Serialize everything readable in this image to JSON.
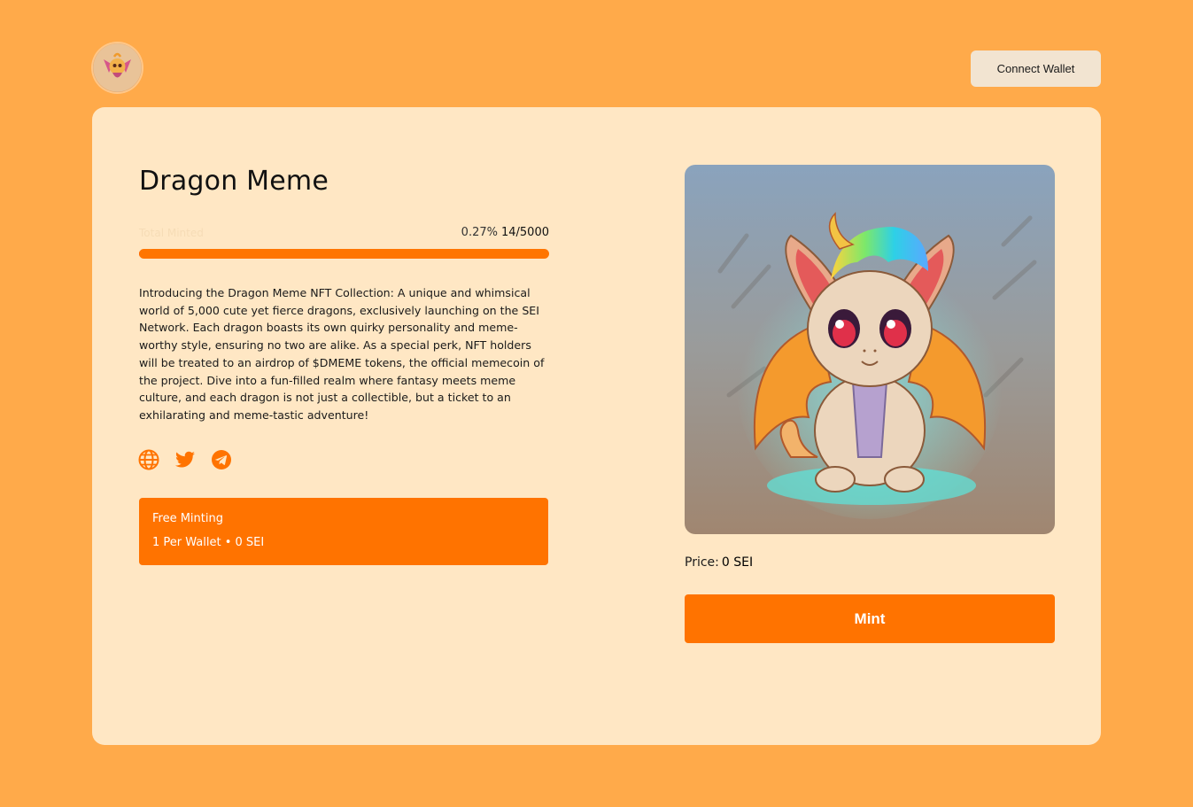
{
  "header": {
    "logo_icon": "dragon-avatar-icon",
    "connect_wallet_label": "Connect Wallet"
  },
  "collection": {
    "title": "Dragon Meme",
    "progress": {
      "label": "Total Minted",
      "percent_text": "0.27%",
      "count_text": "14/5000",
      "fraction": 0.0027
    },
    "description": "Introducing the Dragon Meme NFT Collection: A unique and whimsical world of 5,000 cute yet fierce dragons, exclusively launching on the SEI Network. Each dragon boasts its own quirky personality and meme-worthy style, ensuring no two are alike. As a special perk, NFT holders will be treated to an airdrop of $DMEME tokens, the official memecoin of the project. Dive into a fun-filled realm where fantasy meets meme culture, and each dragon is not just a collectible, but a ticket to an exhilarating and meme-tastic adventure!",
    "socials": [
      {
        "icon": "globe-icon"
      },
      {
        "icon": "twitter-icon"
      },
      {
        "icon": "telegram-icon"
      }
    ],
    "mint_phase": {
      "name": "Free Minting",
      "details": "1 Per Wallet • 0 SEI"
    }
  },
  "mint_panel": {
    "image_icon": "dragon-nft-image",
    "price_label": "Price:",
    "price_value": "0 SEI",
    "mint_label": "Mint"
  },
  "colors": {
    "page_background": "#FFAA4A",
    "card_background": "#FFE7C4",
    "accent": "#FF7300",
    "connect_button": "#F2E4D1"
  }
}
